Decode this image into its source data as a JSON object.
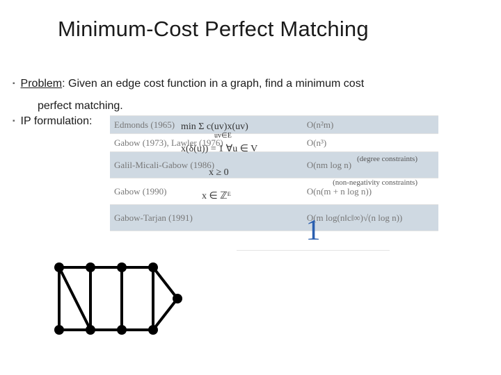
{
  "title": "Minimum-Cost Perfect Matching",
  "bullets": {
    "problem_label": "Problem",
    "problem_text": ": Given an edge cost function in a graph, find a minimum cost",
    "problem_cont": "perfect matching.",
    "ip_label": "IP formulation:"
  },
  "table": {
    "rows": [
      {
        "left": "Edmonds (1965)",
        "right": "O(n²m)",
        "shaded": true
      },
      {
        "left": "Gabow (1973), Lawler (1976)",
        "right": "O(n³)",
        "shaded": false
      },
      {
        "left": "Galil-Micali-Gabow (1986)",
        "right": "O(nm log n)",
        "shaded": true
      },
      {
        "left": "Gabow (1990)",
        "right": "O(n(m + n log n))",
        "shaded": false
      },
      {
        "left": "Gabow-Tarjan (1991)",
        "right": "O(m log(n‖c‖∞)√(n log n))",
        "shaded": true
      }
    ]
  },
  "formulas": {
    "obj": "min  Σ  c(uv)x(uv)",
    "obj_sub": "uv∈E",
    "deg": "x(δ(u)) = 1  ∀u ∈ V",
    "deg_label": "(degree constraints)",
    "nn": "x ≥ 0",
    "nn_label": "(non-negativity constraints)",
    "int": "x ∈ ℤᴱ"
  },
  "big_one": "1"
}
